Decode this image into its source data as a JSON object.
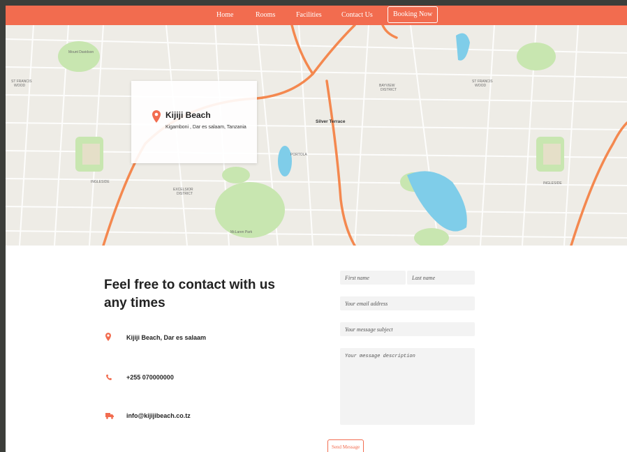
{
  "nav": {
    "items": [
      "Home",
      "Rooms",
      "Facilities",
      "Contact Us"
    ],
    "booking_label": "Booking Now"
  },
  "map": {
    "labels": [
      "Kijiji Beach",
      "Silver Terrace",
      "PORTOLA",
      "EXCELSIOR DISTRICT",
      "INGLESIDE",
      "BAYVIEW DISTRICT",
      "McLaren Park",
      "ST FRANCIS WOOD",
      "Mount Davidson"
    ]
  },
  "card": {
    "title": "Kijiji Beach",
    "address": "Kigamboni , Dar es salaam, Tanzania"
  },
  "contact": {
    "heading": "Feel free to contact with us any times",
    "items": [
      {
        "icon": "location-pin-icon",
        "text": "Kijiji Beach, Dar es salaam"
      },
      {
        "icon": "phone-icon",
        "text": "+255 070000000"
      },
      {
        "icon": "truck-icon",
        "text": "info@kijijibeach.co.tz"
      }
    ]
  },
  "form": {
    "first_name": "First name",
    "last_name": "Last name",
    "email": "Your email address",
    "subject": "Your message subject",
    "description": "Your message description",
    "send_label": "Send Message"
  },
  "colors": {
    "accent": "#f26c4f",
    "outer_bg": "#3c3e3a",
    "field_bg": "#f3f3f3"
  }
}
